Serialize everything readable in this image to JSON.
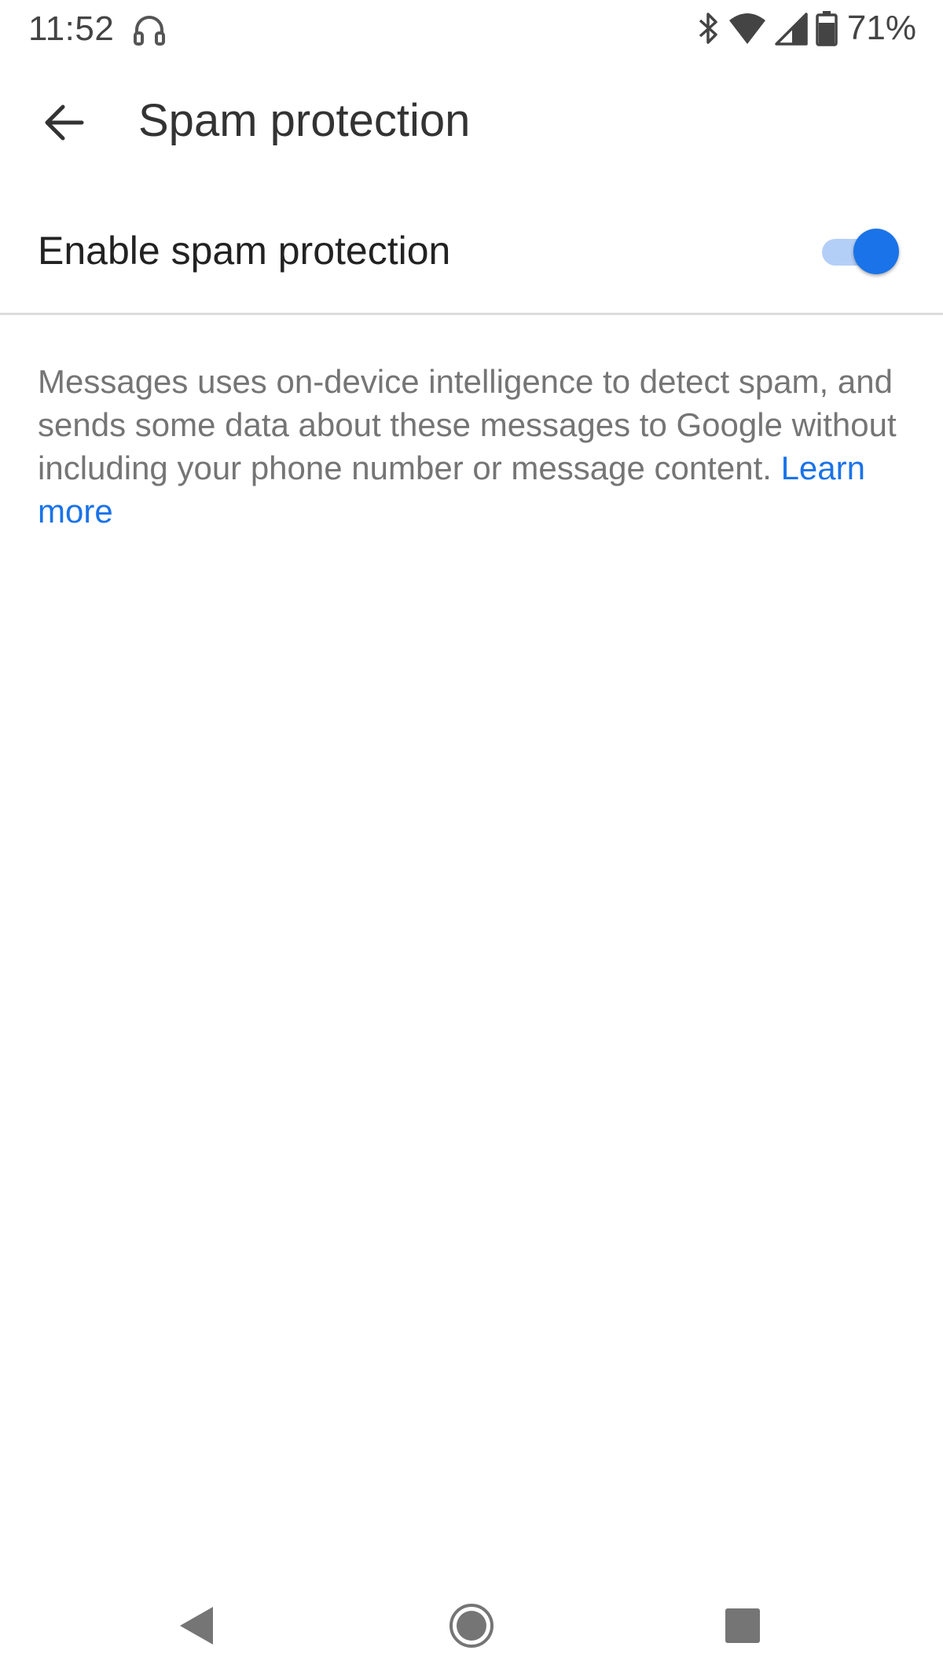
{
  "status_bar": {
    "time": "11:52",
    "battery": "71%",
    "icons": [
      "headset-icon",
      "bluetooth-icon",
      "wifi-icon",
      "cell-signal-icon",
      "battery-icon"
    ]
  },
  "app_bar": {
    "title": "Spam protection",
    "back_icon": "arrow-back-icon"
  },
  "setting": {
    "label": "Enable spam protection",
    "enabled": true
  },
  "description": {
    "text": "Messages uses on-device intelligence to detect spam, and sends some data about these messages to Google without including your phone number or message content.",
    "link_label": "Learn more"
  },
  "nav_bar": {
    "icons": [
      "nav-back-icon",
      "nav-home-icon",
      "nav-recents-icon"
    ]
  },
  "colors": {
    "accent": "#1a73e8",
    "track": "#b4cff7",
    "title_text": "#333333",
    "body_text": "#757575",
    "divider": "#dcdcdc"
  }
}
